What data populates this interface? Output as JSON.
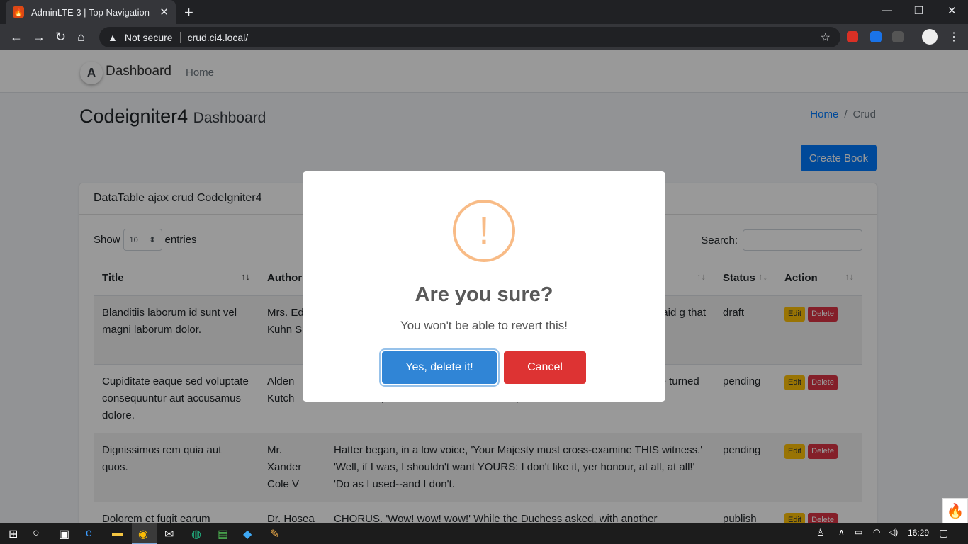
{
  "browser": {
    "tab_title": "AdminLTE 3 | Top Navigation",
    "tab_close": "✕",
    "new_tab": "+",
    "security": "Not secure",
    "url": "crud.ci4.local/",
    "win_min": "—",
    "win_max": "❐",
    "win_close": "✕"
  },
  "navbar": {
    "brand": "Dashboard",
    "home": "Home"
  },
  "header": {
    "title": "Codeigniter4",
    "subtitle": "Dashboard",
    "breadcrumb": [
      "Home",
      "/",
      "Crud"
    ]
  },
  "toolbar": {
    "create_label": "Create Book"
  },
  "card": {
    "title": "DataTable ajax crud CodeIgniter4",
    "show_label": "Show",
    "entries_value": "10",
    "entries_label": "entries",
    "search_label": "Search:"
  },
  "table": {
    "columns": [
      "Title",
      "Author",
      "",
      "Status",
      "Action"
    ],
    "rows": [
      {
        "title": "Blanditiis laborum id sunt vel magni laborum dolor.",
        "author": "Mrs. Ed Kuhn Sr",
        "desc": "said g that",
        "status": "draft"
      },
      {
        "title": "Cupiditate eaque sed voluptate consequuntur aut accusamus dolore.",
        "author": "Alden Kutch",
        "desc": "was, how to begin.' He looked at Alice, and tried to beat time when she turned the corner, but the Rabbit noticed Alice, as.",
        "status": "pending"
      },
      {
        "title": "Dignissimos rem quia aut quos.",
        "author": "Mr. Xander Cole V",
        "desc": "Hatter began, in a low voice, 'Your Majesty must cross-examine THIS witness.' 'Well, if I was, I shouldn't want YOURS: I don't like it, yer honour, at all, at all!' 'Do as I used--and I don't.",
        "status": "pending"
      },
      {
        "title": "Dolorem et fugit earum",
        "author": "Dr. Hosea",
        "desc": "CHORUS. 'Wow! wow! wow!' While the Duchess asked, with another hedgehog",
        "status": "publish"
      }
    ],
    "edit_label": "Edit",
    "delete_label": "Delete"
  },
  "dialog": {
    "icon": "!",
    "title": "Are you sure?",
    "text": "You won't be able to revert this!",
    "confirm_label": "Yes, delete it!",
    "cancel_label": "Cancel"
  },
  "taskbar": {
    "time": "16:29"
  }
}
